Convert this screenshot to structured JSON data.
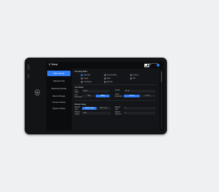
{
  "header": {
    "back_label": "Setup",
    "status_line1": "Disconnected",
    "status_line2": "Idle",
    "accent": "#2f7ef5"
  },
  "nav": [
    {
      "label": "Video Setup",
      "active": true
    },
    {
      "label": "Network Info",
      "active": false
    },
    {
      "label": "Streaming Setup",
      "active": false
    },
    {
      "label": "Record Setup",
      "active": false
    },
    {
      "label": "Camera Setup",
      "active": false
    },
    {
      "label": "System Setup",
      "active": false
    }
  ],
  "video": {
    "encoding_title": "Encoding Mode",
    "modes": [
      {
        "label": "Standard",
        "selected": true
      },
      {
        "label": "Pro encoding",
        "selected": false
      },
      {
        "label": "Custom",
        "selected": false
      },
      {
        "label": "Single",
        "selected": false
      },
      {
        "label": "Dual",
        "selected": false
      },
      {
        "label": "Hdr",
        "selected": false
      },
      {
        "label": "Low Power",
        "selected": false
      },
      {
        "label": "Remote",
        "selected": false
      }
    ],
    "layout_title": "Live Setup",
    "live_mode_label": "Live Mode",
    "live_mode_value": "Single",
    "layout_label": "Layout",
    "layout_value": "4x4 M",
    "live_res_label": "Live Resolution",
    "res_options": [
      "720p",
      "1080p"
    ],
    "live_res_selected": 1,
    "local_res_label": "Local Resolution",
    "local_res_options": [
      "Source",
      "Custom"
    ],
    "local_res_selected": 0,
    "display_title": "Monitor Setup",
    "monitor_type_label": "Monitor Type",
    "monitor_type_options": [
      "Single mode",
      "Multi mode"
    ],
    "monitor_type_selected": 0,
    "monitor_grid_label": "Monitor Grid",
    "monitor_grid_value": "2",
    "monitor_layout_label": "Monitor Layout",
    "monitor_layout_value": "Multi",
    "monitor_src_label": "Monitor Source 2",
    "monitor_src_value": "2"
  }
}
